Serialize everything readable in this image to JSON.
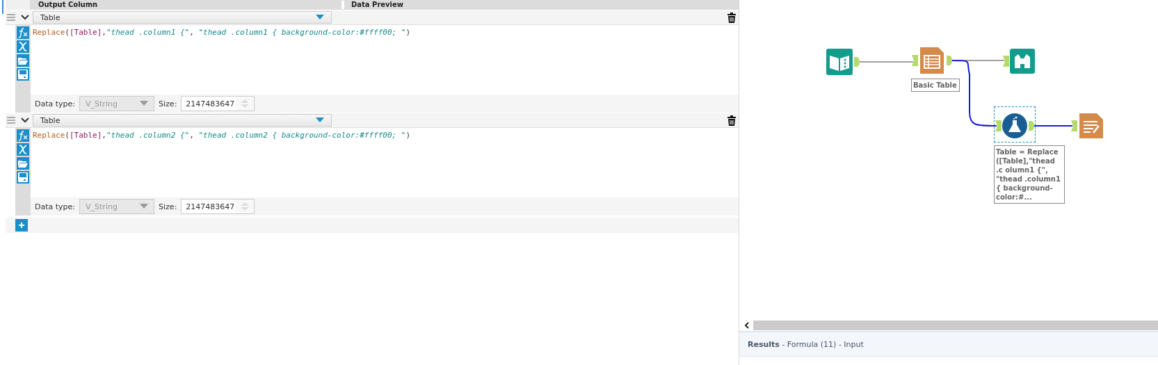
{
  "config_header": {
    "columns": [
      "Output Column",
      "Data Preview"
    ]
  },
  "formulas": [
    {
      "output_column": "Table",
      "expanded": true,
      "expression": [
        {
          "kind": "function",
          "text": "Replace"
        },
        {
          "kind": "punct",
          "text": "("
        },
        {
          "kind": "field",
          "text": "[Table]"
        },
        {
          "kind": "punct",
          "text": ","
        },
        {
          "kind": "string",
          "text": "\"thead .column1 {\""
        },
        {
          "kind": "punct",
          "text": ", "
        },
        {
          "kind": "string",
          "text": "\"thead .column1 { background-color:#ffff00; \""
        },
        {
          "kind": "punct",
          "text": ")"
        }
      ],
      "data_type_label": "Data type:",
      "data_type": "V_String",
      "size_label": "Size:",
      "size": "2147483647"
    },
    {
      "output_column": "Table",
      "expanded": true,
      "expression": [
        {
          "kind": "function",
          "text": "Replace"
        },
        {
          "kind": "punct",
          "text": "("
        },
        {
          "kind": "field",
          "text": "[Table]"
        },
        {
          "kind": "punct",
          "text": ","
        },
        {
          "kind": "string",
          "text": "\"thead .column2 {\""
        },
        {
          "kind": "punct",
          "text": ", "
        },
        {
          "kind": "string",
          "text": "\"thead .column2 { background-color:#ffff00; \""
        },
        {
          "kind": "punct",
          "text": ")"
        }
      ],
      "data_type_label": "Data type:",
      "data_type": "V_String",
      "size_label": "Size:",
      "size": "2147483647"
    }
  ],
  "canvas": {
    "nodes": [
      {
        "kind": "input",
        "selected": false
      },
      {
        "kind": "table",
        "label": "Basic Table",
        "selected": false
      },
      {
        "kind": "browse",
        "selected": false
      },
      {
        "kind": "formula",
        "label": "Table = Replace ([Table],\"thead .c olumn1 {\", \"thead .column1 { background-color:#...",
        "selected": true
      },
      {
        "kind": "report",
        "selected": false
      }
    ],
    "connections": [
      {
        "highlighted": false
      },
      {
        "highlighted": false
      },
      {
        "highlighted": true
      },
      {
        "highlighted": true
      }
    ]
  },
  "results_bar": {
    "text": "**Results** - Formula (11) - Input"
  }
}
